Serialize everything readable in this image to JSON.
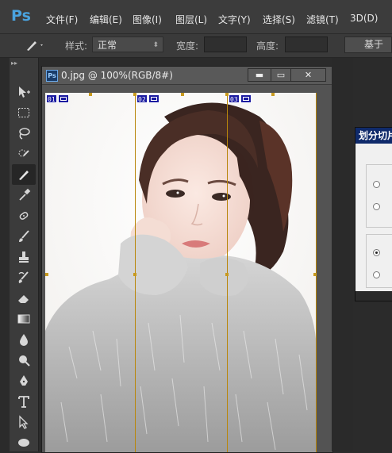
{
  "app": {
    "logo": "Ps"
  },
  "menu": [
    "文件(F)",
    "编辑(E)",
    "图像(I)",
    "图层(L)",
    "文字(Y)",
    "选择(S)",
    "滤镜(T)",
    "3D(D)"
  ],
  "options": {
    "style_label": "样式:",
    "style_value": "正常",
    "width_label": "宽度:",
    "height_label": "高度:",
    "button_label": "基于"
  },
  "toolbar": {
    "collapse": "▸▸",
    "tools": [
      "move-tool",
      "marquee-tool",
      "lasso-tool",
      "quick-select-tool",
      "slice-tool",
      "eyedropper-tool",
      "healing-tool",
      "brush-tool",
      "stamp-tool",
      "history-brush-tool",
      "eraser-tool",
      "gradient-tool",
      "blur-tool",
      "dodge-tool",
      "pen-tool",
      "type-tool",
      "path-select-tool",
      "ellipse-tool"
    ],
    "active": "slice-tool"
  },
  "document": {
    "title": "0.jpg @ 100%(RGB/8#)",
    "badge": "Ps",
    "minimize": "▬",
    "maximize": "▭",
    "close": "✕",
    "slices": [
      "01",
      "02",
      "03"
    ]
  },
  "dialog": {
    "title": "划分切片"
  },
  "colors": {
    "accent": "#4aa3df",
    "slice_line": "#b8860b",
    "slice_tag": "#1a1aa0",
    "dialog_title": "#0f2a6b"
  }
}
